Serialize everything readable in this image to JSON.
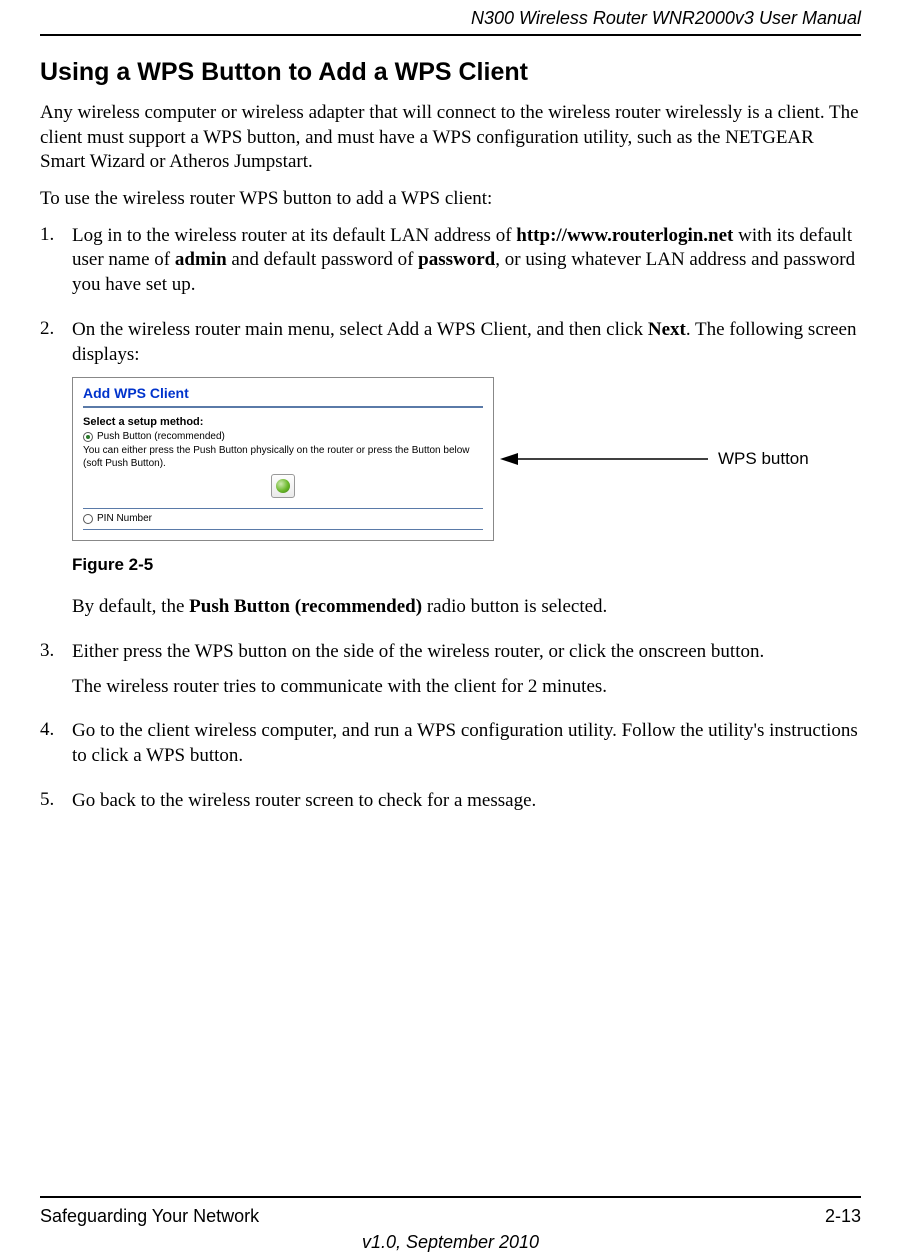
{
  "header": {
    "doc_title": "N300 Wireless Router WNR2000v3 User Manual"
  },
  "section": {
    "title": "Using a WPS Button to Add a WPS Client",
    "intro_p1": "Any wireless computer or wireless adapter that will connect to the wireless router wirelessly is a client. The client must support a WPS button, and must have a WPS configuration utility, such as the NETGEAR Smart Wizard or Atheros Jumpstart.",
    "intro_p2": "To use the wireless router WPS button to add a WPS client:"
  },
  "steps": {
    "s1": {
      "num": "1.",
      "pre": "Log in to the wireless router at its default LAN address of ",
      "b1": "http://www.routerlogin.net",
      "mid1": " with its default user name of ",
      "b2": "admin",
      "mid2": " and default password of ",
      "b3": "password",
      "post": ", or using whatever LAN address and password you have set up."
    },
    "s2": {
      "num": "2.",
      "pre": "On the wireless router main menu, select Add a WPS Client, and then click ",
      "b1": "Next",
      "post": ". The following screen displays:",
      "after_fig_pre": "By default, the ",
      "after_fig_b": "Push Button (recommended)",
      "after_fig_post": " radio button is selected."
    },
    "s3": {
      "num": "3.",
      "p1": "Either press the WPS button on the side of the wireless router, or click the onscreen button.",
      "p2": "The wireless router tries to communicate with the client for 2 minutes."
    },
    "s4": {
      "num": "4.",
      "p1": "Go to the client wireless computer, and run a WPS configuration utility. Follow the utility's instructions to click a WPS button."
    },
    "s5": {
      "num": "5.",
      "p1": "Go back to the wireless router screen to check for a message."
    }
  },
  "figure": {
    "title": "Add WPS Client",
    "heading": "Select a setup method:",
    "opt1": "Push Button (recommended)",
    "note": "You can either press the Push Button physically on the router or press the Button below (soft Push Button).",
    "opt2": "PIN Number",
    "callout": "WPS button",
    "caption": "Figure 2-5"
  },
  "footer": {
    "left": "Safeguarding Your Network",
    "right": "2-13",
    "center": "v1.0, September 2010"
  }
}
